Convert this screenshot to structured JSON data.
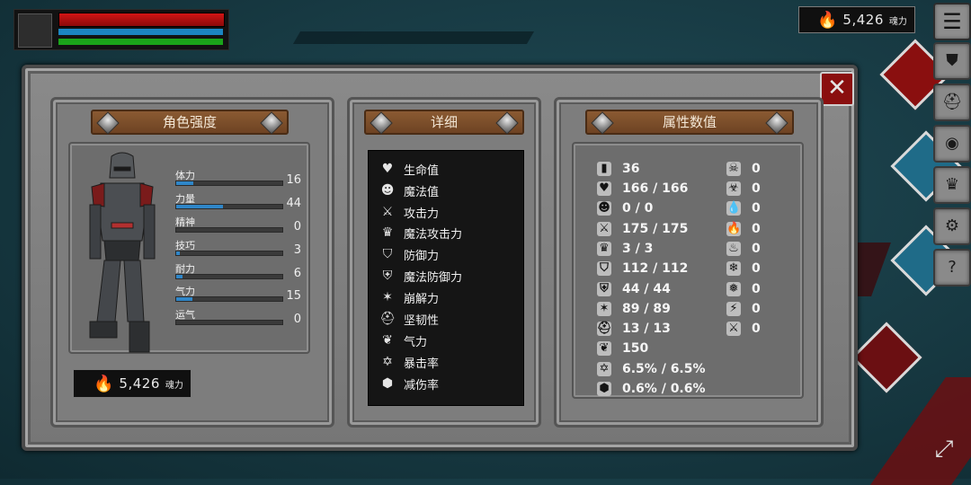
{
  "souls": {
    "value": "5,426",
    "unit": "魂力"
  },
  "window": {
    "left_panel": {
      "title": "角色强度",
      "stats": [
        {
          "label": "体力",
          "value": "16",
          "fill": 0.16
        },
        {
          "label": "力量",
          "value": "44",
          "fill": 0.44
        },
        {
          "label": "精神",
          "value": "0",
          "fill": 0.0
        },
        {
          "label": "技巧",
          "value": "3",
          "fill": 0.03
        },
        {
          "label": "耐力",
          "value": "6",
          "fill": 0.06
        },
        {
          "label": "气力",
          "value": "15",
          "fill": 0.15
        },
        {
          "label": "运气",
          "value": "0",
          "fill": 0.0
        }
      ],
      "souls_value": "5,426",
      "souls_unit": "魂力"
    },
    "middle_panel": {
      "title": "详细",
      "items": [
        {
          "icon": "heart-icon",
          "label": "生命值"
        },
        {
          "icon": "head-icon",
          "label": "魔法值"
        },
        {
          "icon": "sword-icon",
          "label": "攻击力"
        },
        {
          "icon": "crown-icon",
          "label": "魔法攻击力"
        },
        {
          "icon": "shield-icon",
          "label": "防御力"
        },
        {
          "icon": "magic-shield-icon",
          "label": "魔法防御力"
        },
        {
          "icon": "break-icon",
          "label": "崩解力"
        },
        {
          "icon": "helmet-icon",
          "label": "坚韧性"
        },
        {
          "icon": "lungs-icon",
          "label": "气力"
        },
        {
          "icon": "star-icon",
          "label": "暴击率"
        },
        {
          "icon": "guard-icon",
          "label": "减伤率"
        }
      ]
    },
    "right_panel": {
      "title": "属性数值",
      "left_column": [
        {
          "icon": "level-icon",
          "value": "36"
        },
        {
          "icon": "heart-icon",
          "value": "166 / 166"
        },
        {
          "icon": "head-icon",
          "value": "0 / 0"
        },
        {
          "icon": "sword-icon",
          "value": "175 / 175"
        },
        {
          "icon": "crown-icon",
          "value": "3 / 3"
        },
        {
          "icon": "shield-icon",
          "value": "112 / 112"
        },
        {
          "icon": "magic-shield-icon",
          "value": "44 / 44"
        },
        {
          "icon": "break-icon",
          "value": "89 / 89"
        },
        {
          "icon": "helmet-icon",
          "value": "13 / 13"
        },
        {
          "icon": "lungs-icon",
          "value": "150"
        },
        {
          "icon": "star-icon",
          "value": "6.5% / 6.5%"
        },
        {
          "icon": "guard-icon",
          "value": "0.6% / 0.6%"
        }
      ],
      "right_column": [
        {
          "icon": "skull-icon",
          "value": "0"
        },
        {
          "icon": "poison-skull-icon",
          "value": "0"
        },
        {
          "icon": "bleed-icon",
          "value": "0"
        },
        {
          "icon": "fire-icon",
          "value": "0"
        },
        {
          "icon": "burn-icon",
          "value": "0"
        },
        {
          "icon": "frost-icon",
          "value": "0"
        },
        {
          "icon": "ice-icon",
          "value": "0"
        },
        {
          "icon": "lightning-icon",
          "value": "0"
        },
        {
          "icon": "sword-break-icon",
          "value": "0"
        }
      ]
    }
  },
  "side_menu": [
    "list-icon",
    "armor-icon",
    "helmet-icon",
    "emblem-icon",
    "crown-icon",
    "gear-icon",
    "help-icon"
  ],
  "colors": {
    "hp": "#c01010",
    "mp": "#1b86c2",
    "stamina": "#1aa41a",
    "close": "#8a0f0f",
    "plaque": "#7a4b28"
  }
}
